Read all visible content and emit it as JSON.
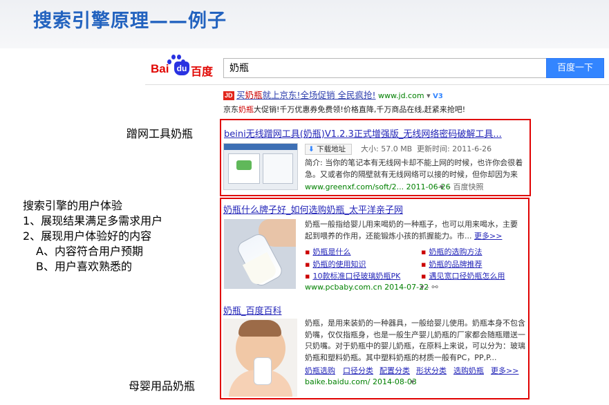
{
  "slide": {
    "title": "搜索引擎原理——例子"
  },
  "logo": {
    "bai": "Bai",
    "du": "du",
    "cn": "百度"
  },
  "search": {
    "query": "奶瓶",
    "button": "百度一下"
  },
  "ad": {
    "badge": "JD",
    "title_pre": "买",
    "title_kw": "奶瓶",
    "title_post": "就上京东!全场促销 全民疯抢!",
    "url": "www.jd.com",
    "v3": "V3",
    "desc_pre": "京东",
    "desc_kw": "奶瓶",
    "desc_post": "大促销!千万优惠券免费领!价格直降,千万商品在线,赶紧来抢吧!"
  },
  "labels": {
    "cheat": "蹭网工具奶瓶",
    "ux_title": "搜索引擎的用户体验",
    "ux_1": "1、展现结果满足多需求用户",
    "ux_2": "2、展现用户体验好的内容",
    "ux_a": "A、内容符合用户预期",
    "ux_b": "B、用户喜欢熟悉的",
    "baby": "母婴用品奶瓶"
  },
  "results": {
    "r1": {
      "title": "beini无线蹭网工具(奶瓶)V1.2.3正式增强版_无线网络密码破解工具...",
      "download": "下载地址",
      "size": "大小: 57.0 MB",
      "updated": "更新时间: 2011-6-26",
      "desc": "简介: 当你的笔记本有无线网卡却不能上网的时候，也许你会很着急。又或者你的隔壁就有无线网络可以接的时候，但你却因为来自...",
      "url": "www.greenxf.com/soft/2... 2011-06-26",
      "snapshot": "- 百度快照"
    },
    "r2": {
      "title": "奶瓶什么牌子好_如何选购奶瓶_太平洋亲子网",
      "desc": "奶瓶一般指给婴儿用来喝奶的一种瓶子，也可以用来喝水，主要起到喂养的作用，还能锻炼小孩的抓握能力。市...",
      "more": "更多>>",
      "links": [
        "奶瓶是什么",
        "奶瓶的选购方法",
        "奶瓶的使用知识",
        "奶瓶的品牌推荐",
        "10款标准口径玻璃奶瓶PK",
        "遇见宽口径奶瓶怎么用"
      ],
      "url": "www.pcbaby.com.cn 2014-07-22"
    },
    "r3": {
      "title": "奶瓶_百度百科",
      "desc": "奶瓶，是用来装奶的一种器具，一般给婴儿使用。奶瓶本身不包含奶嘴，仅仅指瓶身，也是一般生产婴儿奶瓶的厂家都会随瓶赠送一只奶嘴。对于奶瓶中的婴儿奶瓶，在原料上来说，可以分为：玻璃奶瓶和塑料奶瓶。其中塑料奶瓶的材质一般有PC，PP,P...",
      "links": [
        "奶瓶选购",
        "口径分类",
        "配置分类",
        "形状分类",
        "选购奶瓶",
        "更多>>"
      ],
      "url": "baike.baidu.com/ 2014-08-03"
    }
  }
}
